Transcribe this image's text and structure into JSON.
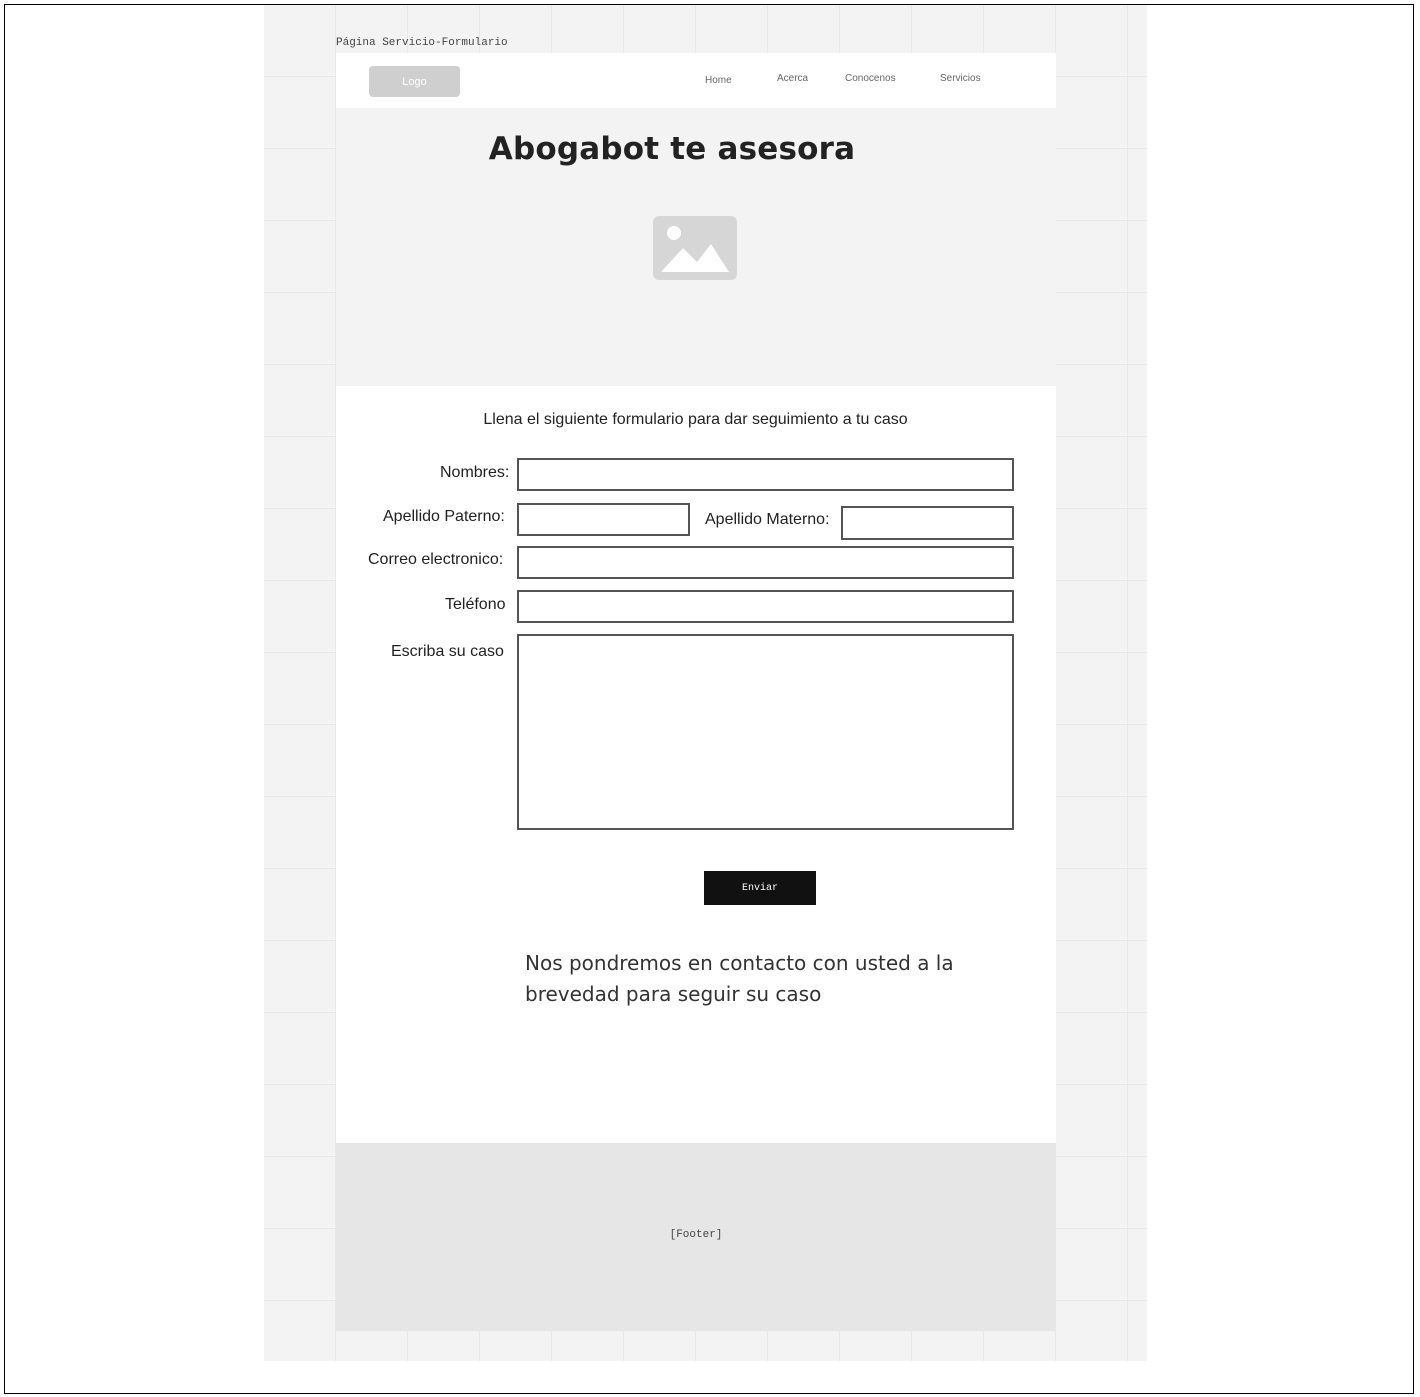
{
  "canvas": {
    "frame_label": "Página Servicio-Formulario"
  },
  "header": {
    "logo_label": "Logo",
    "nav": [
      "Home",
      "Acerca",
      "Conocenos",
      "Servicios"
    ]
  },
  "hero": {
    "title": "Abogabot te asesora",
    "image_icon": "image-placeholder-icon"
  },
  "form": {
    "intro": "Llena el siguiente formulario para dar seguimiento a tu caso",
    "labels": {
      "nombres": "Nombres:",
      "apellido_paterno": "Apellido Paterno:",
      "apellido_materno": "Apellido Materno:",
      "correo": "Correo electronico:",
      "telefono": "Teléfono",
      "caso": "Escriba su caso"
    },
    "values": {
      "nombres": "",
      "apellido_paterno": "",
      "apellido_materno": "",
      "correo": "",
      "telefono": "",
      "caso": ""
    },
    "submit_label": "Enviar",
    "contact_message": "Nos pondremos en contacto con usted a la brevedad para seguir su caso"
  },
  "footer": {
    "text": "[Footer]"
  },
  "colors": {
    "canvas_bg": "#f3f3f3",
    "hero_bg": "#f3f3f3",
    "footer_bg": "#e6e6e6",
    "logo_bg": "#cfcfcf",
    "button_bg": "#111111"
  }
}
